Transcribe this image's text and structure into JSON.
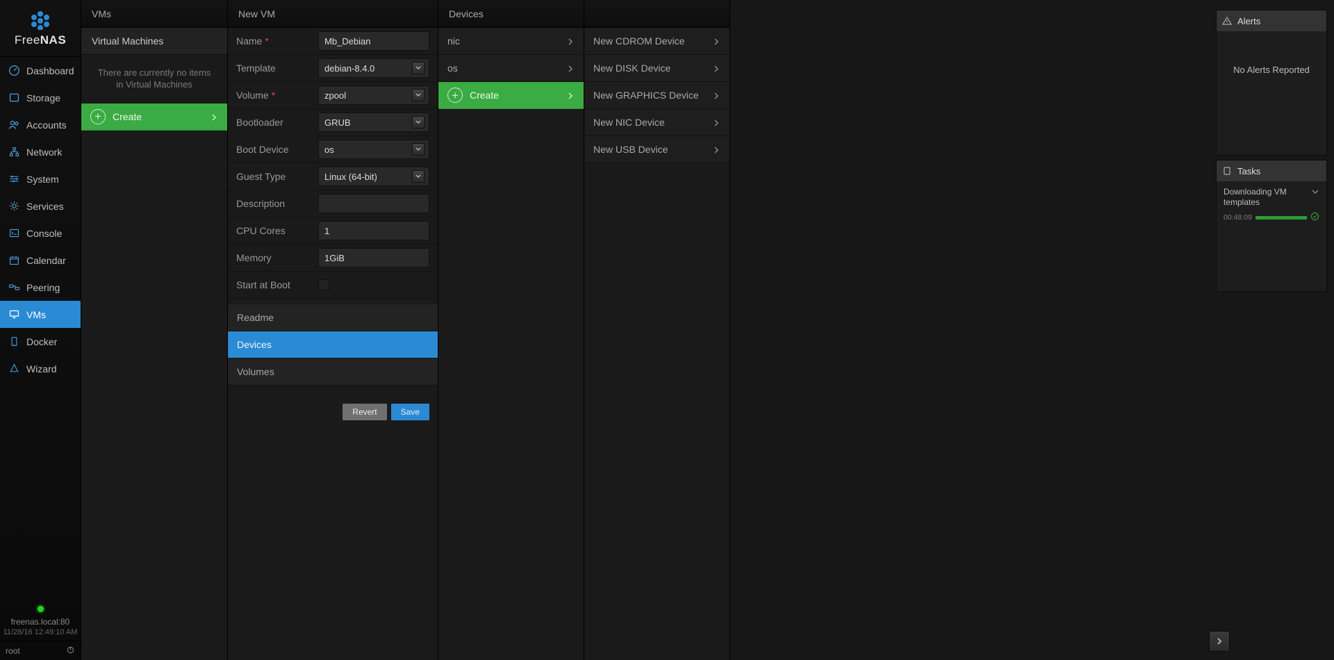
{
  "brand": {
    "name": "FreeNAS",
    "prefix": "Free",
    "suffix": "NAS"
  },
  "sidebar": {
    "items": [
      {
        "label": "Dashboard"
      },
      {
        "label": "Storage"
      },
      {
        "label": "Accounts"
      },
      {
        "label": "Network"
      },
      {
        "label": "System"
      },
      {
        "label": "Services"
      },
      {
        "label": "Console"
      },
      {
        "label": "Calendar"
      },
      {
        "label": "Peering"
      },
      {
        "label": "VMs"
      },
      {
        "label": "Docker"
      },
      {
        "label": "Wizard"
      }
    ],
    "host": "freenas.local:80",
    "datetime": "11/28/16  12:49:10 AM",
    "user": "root"
  },
  "col1": {
    "title": "VMs",
    "subtitle": "Virtual Machines",
    "empty": "There are currently no items in Virtual Machines",
    "create": "Create"
  },
  "col2": {
    "title": "New VM",
    "fields": {
      "name_label": "Name",
      "name_value": "Mb_Debian",
      "template_label": "Template",
      "template_value": "debian-8.4.0",
      "volume_label": "Volume",
      "volume_value": "zpool",
      "bootloader_label": "Bootloader",
      "bootloader_value": "GRUB",
      "bootdevice_label": "Boot Device",
      "bootdevice_value": "os",
      "guesttype_label": "Guest Type",
      "guesttype_value": "Linux (64-bit)",
      "description_label": "Description",
      "description_value": "",
      "cpu_label": "CPU Cores",
      "cpu_value": "1",
      "memory_label": "Memory",
      "memory_value": "1GiB",
      "startboot_label": "Start at Boot"
    },
    "nav": {
      "readme": "Readme",
      "devices": "Devices",
      "volumes": "Volumes"
    },
    "buttons": {
      "revert": "Revert",
      "save": "Save"
    }
  },
  "col3": {
    "title": "Devices",
    "items": [
      {
        "label": "nic"
      },
      {
        "label": "os"
      }
    ],
    "create": "Create"
  },
  "col4": {
    "items": [
      {
        "label": "New CDROM Device"
      },
      {
        "label": "New DISK Device"
      },
      {
        "label": "New GRAPHICS Device"
      },
      {
        "label": "New NIC Device"
      },
      {
        "label": "New USB Device"
      }
    ]
  },
  "alerts": {
    "title": "Alerts",
    "none": "No Alerts Reported"
  },
  "tasks": {
    "title": "Tasks",
    "item": {
      "name": "Downloading VM templates",
      "time": "00:48:09"
    }
  }
}
